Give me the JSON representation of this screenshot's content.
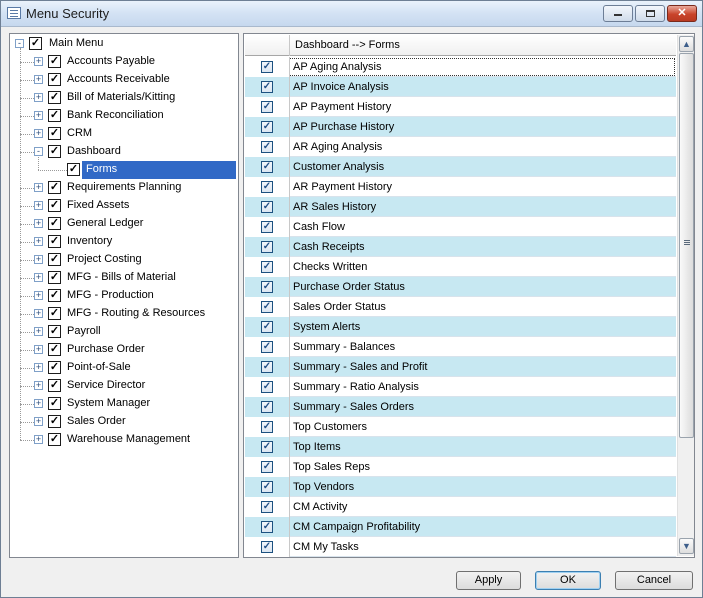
{
  "window": {
    "title": "Menu Security"
  },
  "tree": {
    "root": "Main Menu",
    "items": [
      {
        "label": "Accounts Payable",
        "expander": "+"
      },
      {
        "label": "Accounts Receivable",
        "expander": "+"
      },
      {
        "label": "Bill of Materials/Kitting",
        "expander": "+"
      },
      {
        "label": "Bank Reconciliation",
        "expander": "+"
      },
      {
        "label": "CRM",
        "expander": "+"
      },
      {
        "label": "Dashboard",
        "expander": "-"
      },
      {
        "label": "Forms",
        "child": true,
        "selected": true
      },
      {
        "label": "Requirements Planning",
        "expander": "+"
      },
      {
        "label": "Fixed Assets",
        "expander": "+"
      },
      {
        "label": "General Ledger",
        "expander": "+"
      },
      {
        "label": "Inventory",
        "expander": "+"
      },
      {
        "label": "Project Costing",
        "expander": "+"
      },
      {
        "label": "MFG - Bills of Material",
        "expander": "+"
      },
      {
        "label": "MFG - Production",
        "expander": "+"
      },
      {
        "label": "MFG - Routing & Resources",
        "expander": "+"
      },
      {
        "label": "Payroll",
        "expander": "+"
      },
      {
        "label": "Purchase Order",
        "expander": "+"
      },
      {
        "label": "Point-of-Sale",
        "expander": "+"
      },
      {
        "label": "Service Director",
        "expander": "+"
      },
      {
        "label": "System Manager",
        "expander": "+"
      },
      {
        "label": "Sales Order",
        "expander": "+"
      },
      {
        "label": "Warehouse Management",
        "expander": "+"
      }
    ]
  },
  "grid": {
    "header": "Dashboard  -->  Forms",
    "rows": [
      "AP Aging Analysis",
      "AP Invoice Analysis",
      "AP Payment History",
      "AP Purchase History",
      "AR Aging Analysis",
      "Customer Analysis",
      "AR Payment History",
      "AR Sales History",
      "Cash Flow",
      "Cash Receipts",
      "Checks Written",
      "Purchase Order Status",
      "Sales Order Status",
      "System Alerts",
      "Summary - Balances",
      "Summary - Sales and Profit",
      "Summary - Ratio Analysis",
      "Summary - Sales Orders",
      "Top Customers",
      "Top Items",
      "Top Sales Reps",
      "Top Vendors",
      "CM Activity",
      "CM Campaign Profitability",
      "CM My Tasks"
    ]
  },
  "buttons": {
    "apply": "Apply",
    "ok": "OK",
    "cancel": "Cancel"
  },
  "glyphs": {
    "check": "✓",
    "scroll_up": "▲",
    "scroll_down": "▼",
    "close": "✕"
  },
  "colors": {
    "selection": "#3169c6",
    "alt_row": "#c7e8f2"
  }
}
